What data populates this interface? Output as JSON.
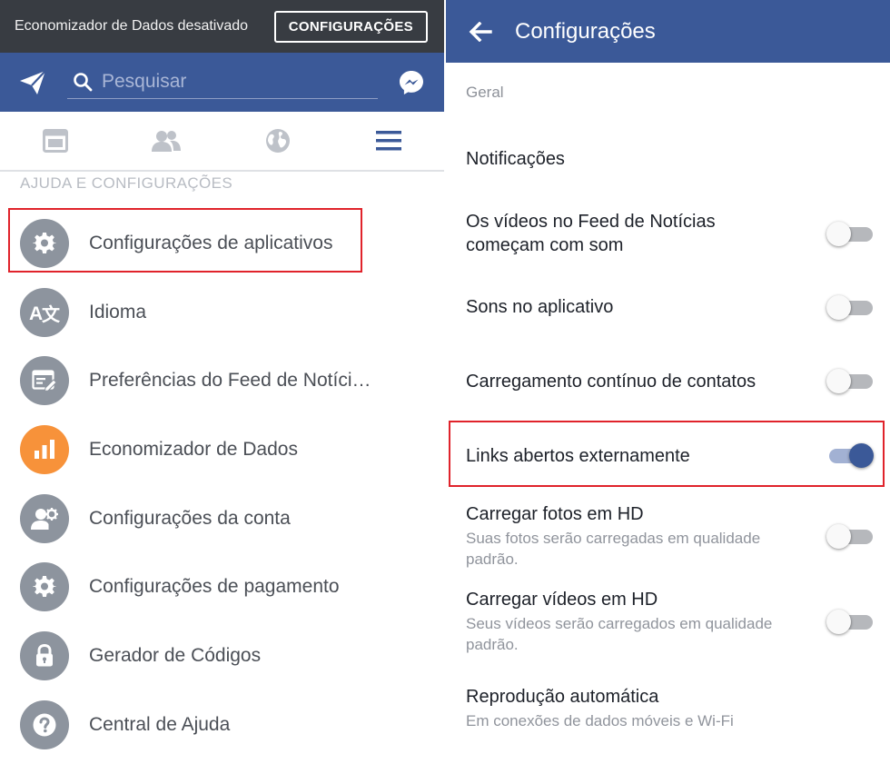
{
  "left": {
    "data_saver": {
      "message": "Economizador de Dados desativado",
      "button_label": "CONFIGURAÇÕES"
    },
    "search": {
      "placeholder": "Pesquisar"
    },
    "section_header": "AJUDA E CONFIGURAÇÕES",
    "menu": [
      {
        "label": "Configurações de aplicativos",
        "icon": "gear-icon"
      },
      {
        "label": "Idioma",
        "icon": "translate-icon"
      },
      {
        "label": "Preferências do Feed de Notíci…",
        "icon": "feed-edit-icon"
      },
      {
        "label": "Economizador de Dados",
        "icon": "bar-chart-icon",
        "color": "#f7923a"
      },
      {
        "label": "Configurações da conta",
        "icon": "user-gear-icon"
      },
      {
        "label": "Configurações de pagamento",
        "icon": "gear-icon"
      },
      {
        "label": "Gerador de Códigos",
        "icon": "lock-icon"
      },
      {
        "label": "Central de Ajuda",
        "icon": "help-icon"
      }
    ]
  },
  "right": {
    "title": "Configurações",
    "section": "Geral",
    "settings": [
      {
        "title": "Notificações"
      },
      {
        "title": "Os vídeos no Feed de Notícias começam com som",
        "enabled": false
      },
      {
        "title": "Sons no aplicativo",
        "enabled": false
      },
      {
        "title": "Carregamento contínuo de contatos",
        "enabled": false
      },
      {
        "title": "Links abertos externamente",
        "enabled": true
      },
      {
        "title": "Carregar fotos em HD",
        "subtitle": "Suas fotos serão carregadas em qualidade padrão.",
        "enabled": false
      },
      {
        "title": "Carregar vídeos em HD",
        "subtitle": "Seus vídeos serão carregados em qualidade padrão.",
        "enabled": false
      },
      {
        "title": "Reprodução automática",
        "subtitle": "Em conexões de dados móveis e Wi-Fi"
      }
    ]
  },
  "colors": {
    "brand": "#3b5998",
    "highlight": "#e0232b",
    "data_saver": "#f7923a"
  }
}
